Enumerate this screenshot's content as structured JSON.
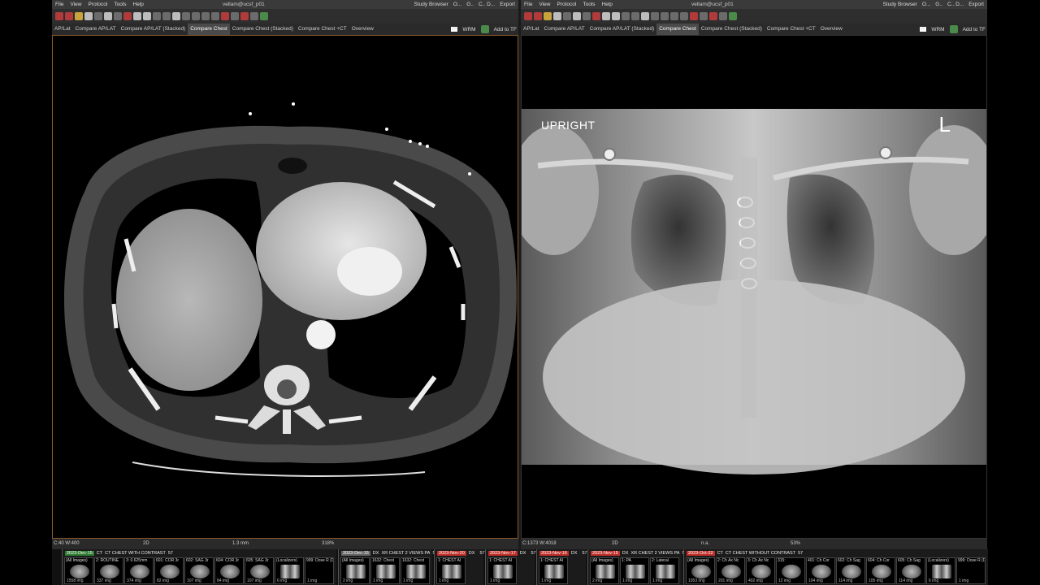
{
  "app": {
    "menu": [
      "File",
      "View",
      "Protocol",
      "Tools",
      "Help"
    ],
    "user": "vellam@ucsf_p01",
    "right_menu": [
      "Study Browser",
      "O...",
      "G..",
      "C.. D...",
      "Export"
    ]
  },
  "tabs": [
    "AP/Lat",
    "Compare AP/LAT",
    "Compare AP/LAT (Stacked)",
    "Compare Chest",
    "Compare Chest (Stacked)",
    "Compare Chest +CT",
    "Overview"
  ],
  "active_tab": "Compare Chest",
  "tabs_right": [
    "WRM",
    "Add to TF"
  ],
  "left_viewer": {
    "status_wl": "C:40 W:400",
    "status_mode": "2D",
    "status_thickness": "1.3 mm",
    "status_zoom": "318%"
  },
  "right_viewer": {
    "overlay_position": "UPRIGHT",
    "overlay_side": "L",
    "status_wl": "C:1373 W:4018",
    "status_mode": "2D",
    "status_thickness": "n.a.",
    "status_zoom": "53%"
  },
  "studies": [
    {
      "date": "2023-Dec-15",
      "mod": "CT",
      "desc": "CT CHEST WITH CONTRAST",
      "count": "57",
      "series": [
        {
          "label": "(All Images)",
          "count": "1558 img",
          "kind": "ct"
        },
        {
          "label": "2: ROUTINE",
          "count": "337 img",
          "kind": "ct"
        },
        {
          "label": "3: 0.625mm",
          "count": "374 img",
          "kind": "ct"
        },
        {
          "label": "601: COR 3r",
          "count": "82 img",
          "kind": "ct"
        },
        {
          "label": "602: SAG 3r",
          "count": "107 img",
          "kind": "ct"
        },
        {
          "label": "604: COR 3r",
          "count": "84 img",
          "kind": "ct"
        },
        {
          "label": "605: SAG 3r",
          "count": "107 img",
          "kind": "ct"
        },
        {
          "label": "(Localizers)",
          "count": "6 img",
          "kind": "xr"
        },
        {
          "label": "999: Dose R (DoseRepor",
          "count": "1 img",
          "kind": "none"
        }
      ]
    },
    {
      "date": "2023-Dec-15",
      "mod": "DX",
      "desc": "XR CHEST 2 VIEWS PA",
      "count": "57",
      "series": [
        {
          "label": "(All Images)",
          "count": "2 img",
          "kind": "xr"
        },
        {
          "label": "1632: Chest",
          "count": "1 img",
          "kind": "xr"
        },
        {
          "label": "1632: Chest",
          "count": "1 img",
          "kind": "xr"
        }
      ]
    },
    {
      "date": "2023-Nov-20",
      "mod": "DX",
      "desc": "",
      "count": "57",
      "series": [
        {
          "label": "1: CHEST AI",
          "count": "1 img",
          "kind": "xr"
        }
      ]
    },
    {
      "date": "2023-Nov-17",
      "mod": "DX",
      "desc": "",
      "count": "57",
      "series": [
        {
          "label": "1: CHEST AI",
          "count": "1 img",
          "kind": "xr"
        }
      ]
    },
    {
      "date": "2023-Nov-16",
      "mod": "DX",
      "desc": "",
      "count": "57",
      "series": [
        {
          "label": "1: CHEST AI",
          "count": "1 img",
          "kind": "xr"
        }
      ]
    },
    {
      "date": "2023-Nov-15",
      "mod": "DX",
      "desc": "XR CHEST 2 VIEWS PA",
      "count": "57",
      "series": [
        {
          "label": "(All Images)",
          "count": "2 img",
          "kind": "xr"
        },
        {
          "label": "1: PA",
          "count": "1 img",
          "kind": "xr"
        },
        {
          "label": "2: Lateral",
          "count": "1 img",
          "kind": "xr"
        }
      ]
    },
    {
      "date": "2023-Oct-22",
      "mod": "CT",
      "desc": "CT CHEST WITHOUT CONTRAST",
      "count": "57",
      "series": [
        {
          "label": "(All Images)",
          "count": "1053 img",
          "kind": "ct"
        },
        {
          "label": "2: Ch Ax Nc",
          "count": "201 img",
          "kind": "ct"
        },
        {
          "label": "3: Ch Ax Nc",
          "count": "402 img",
          "kind": "ct"
        },
        {
          "label": "315:",
          "count": "12 img",
          "kind": "ct"
        },
        {
          "label": "401: Ch Cor",
          "count": "104 img",
          "kind": "ct"
        },
        {
          "label": "602: Ch Sag",
          "count": "114 img",
          "kind": "ct"
        },
        {
          "label": "604: Ch Cor",
          "count": "105 img",
          "kind": "ct"
        },
        {
          "label": "605: Ch Sag",
          "count": "114 img",
          "kind": "ct"
        },
        {
          "label": "(Localizers)",
          "count": "6 img",
          "kind": "xr"
        },
        {
          "label": "999: Dose R (DoseRepor",
          "count": "1 img",
          "kind": "none"
        }
      ]
    }
  ]
}
